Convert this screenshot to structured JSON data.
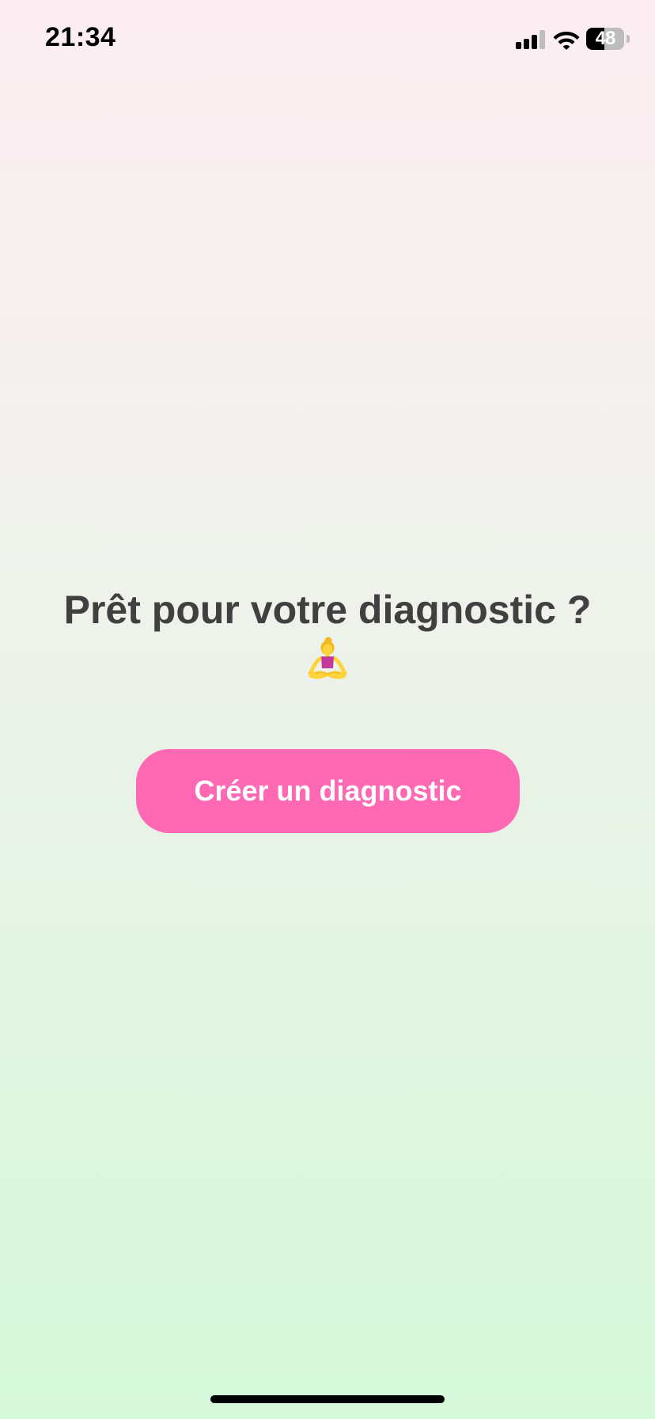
{
  "status_bar": {
    "time": "21:34",
    "battery_level": "48",
    "battery_fraction": 0.48,
    "signal_bars_active": 3,
    "signal_bars_total": 4,
    "signal_icon": "cellular-signal-icon",
    "wifi_icon": "wifi-icon",
    "battery_icon": "battery-icon"
  },
  "main": {
    "headline": "Prêt pour votre diagnostic ?",
    "emoji_icon": "person-meditating-icon",
    "create_button_label": "Créer un diagnostic"
  },
  "colors": {
    "background_top": "#fcedf2",
    "background_bottom": "#d5f8d9",
    "headline_text": "#404040",
    "button_background": "#ff69b4",
    "button_text": "#ffffff",
    "status_text": "#000000",
    "signal_inactive": "#bdbdbd"
  }
}
